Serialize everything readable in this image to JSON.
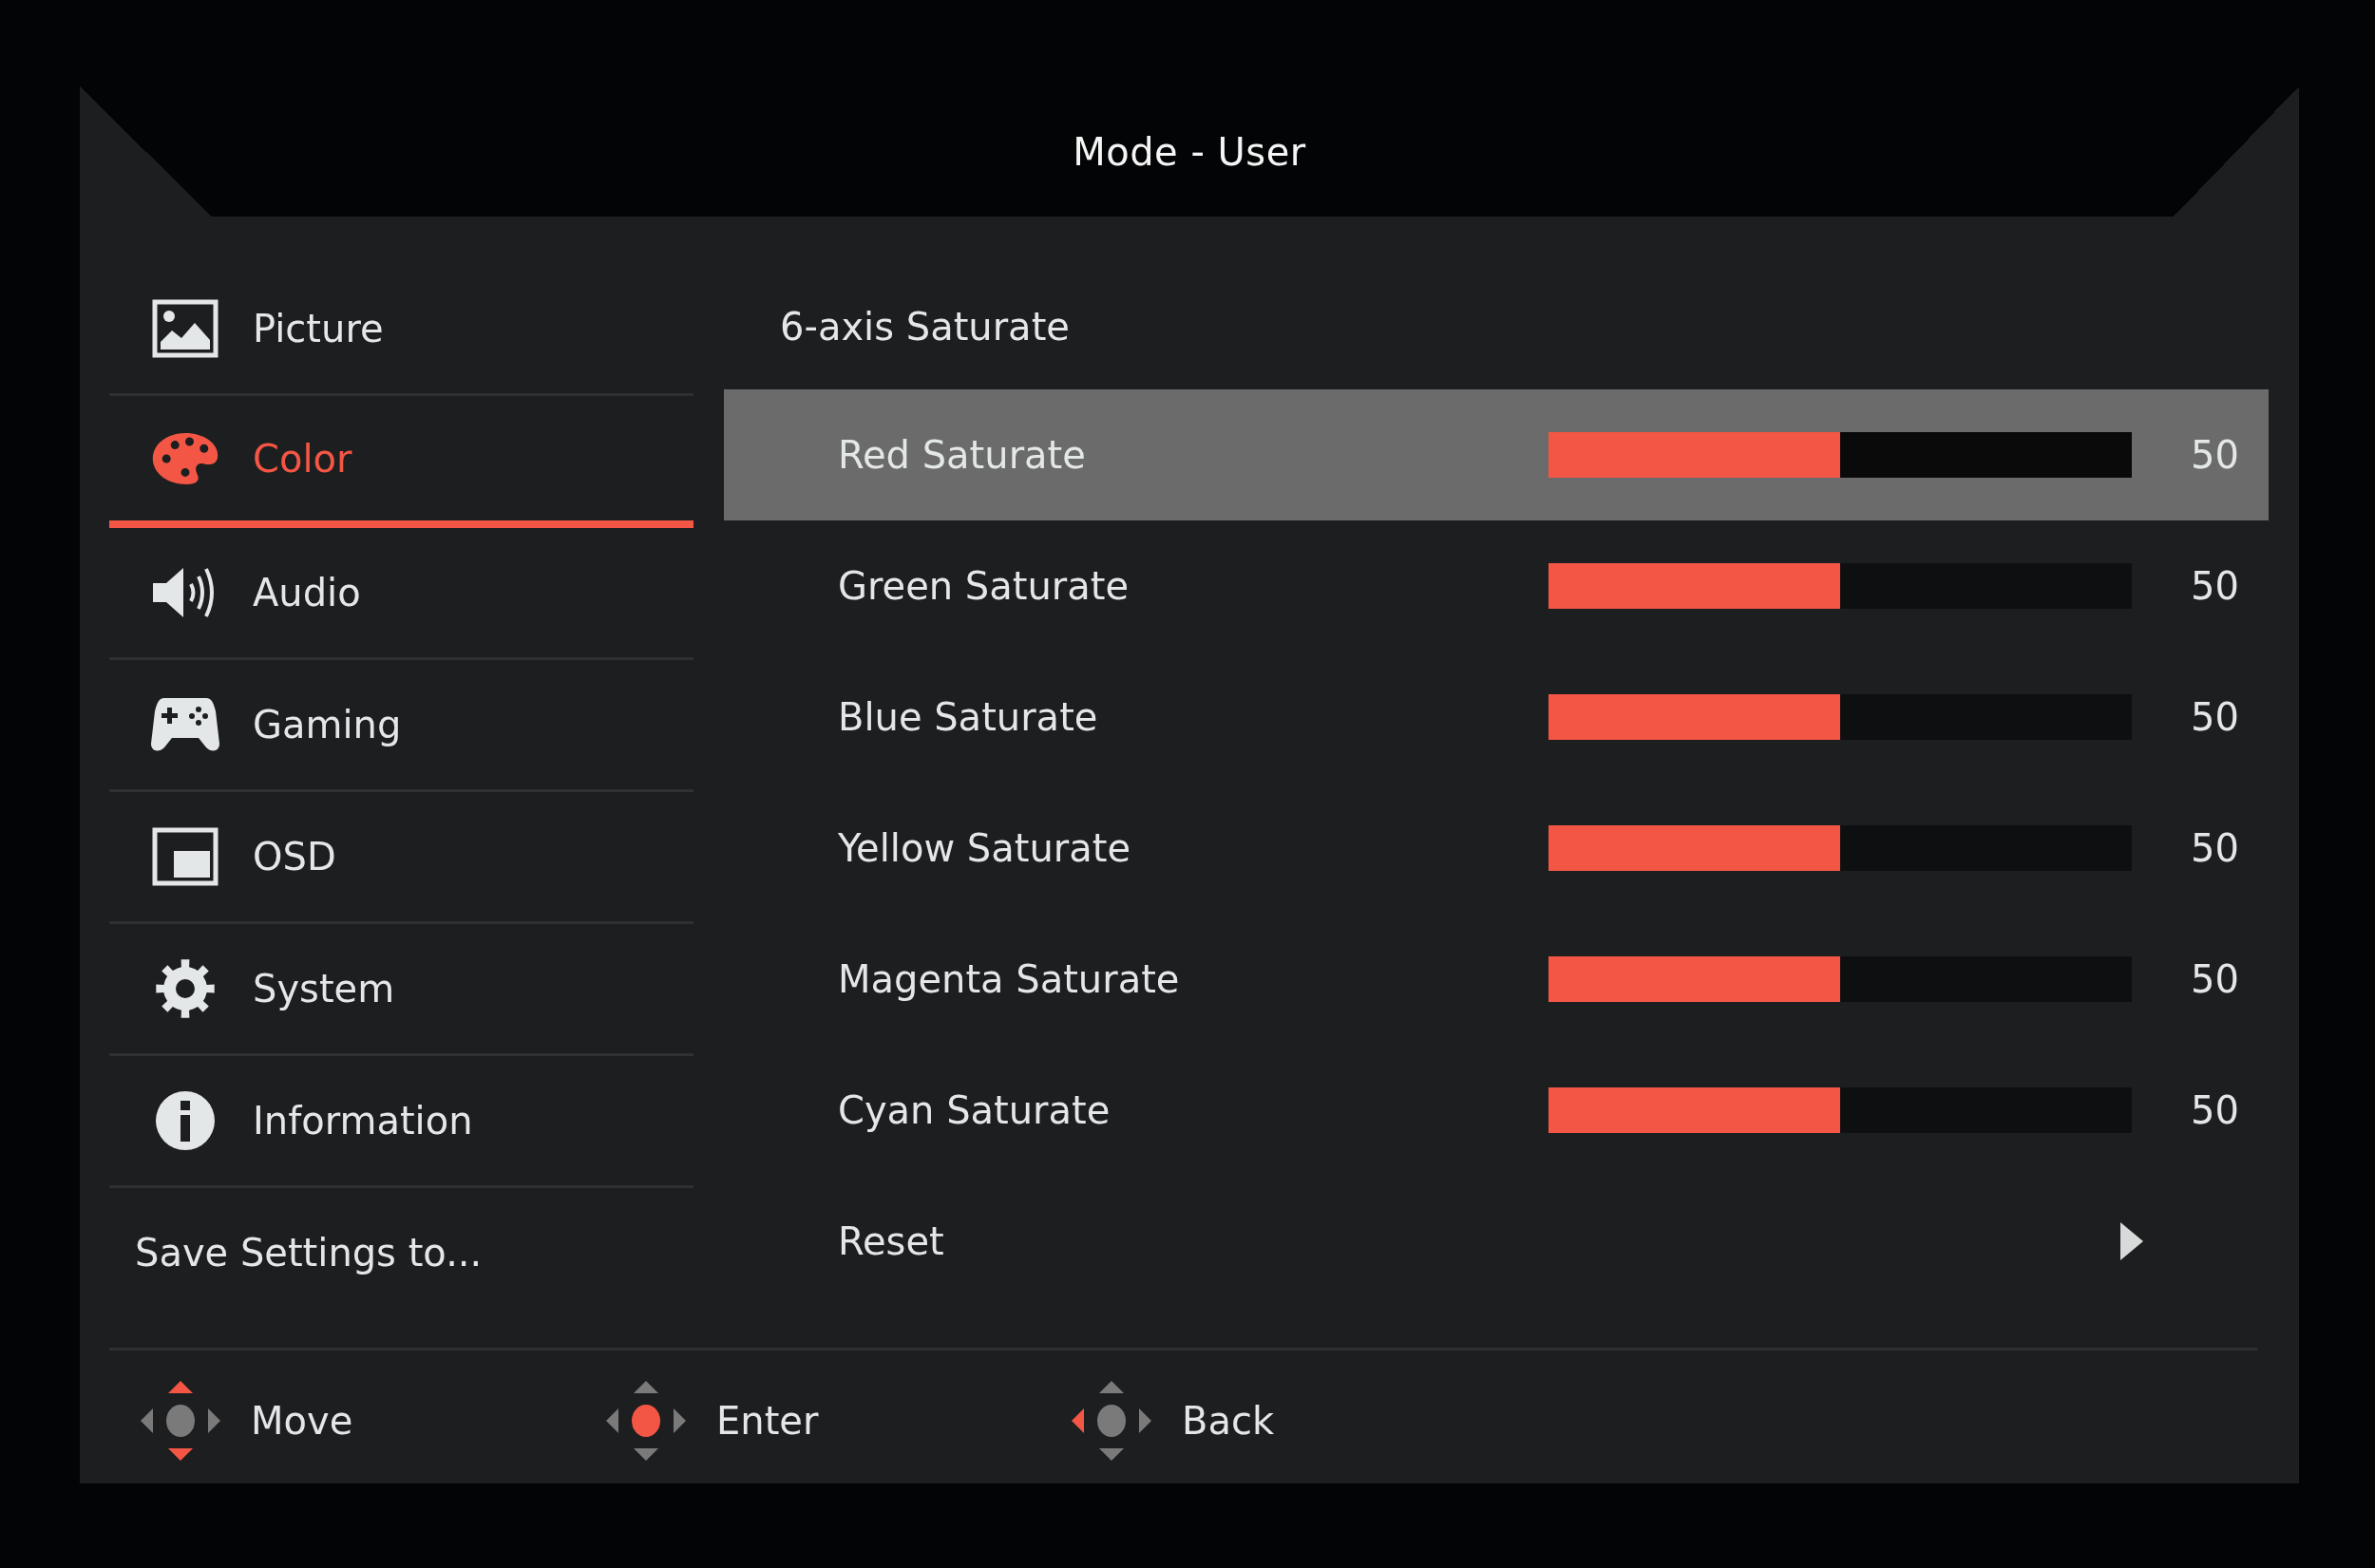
{
  "title": "Mode - User",
  "sidebar": {
    "items": [
      {
        "label": "Picture",
        "selected": false
      },
      {
        "label": "Color",
        "selected": true
      },
      {
        "label": "Audio",
        "selected": false
      },
      {
        "label": "Gaming",
        "selected": false
      },
      {
        "label": "OSD",
        "selected": false
      },
      {
        "label": "System",
        "selected": false
      },
      {
        "label": "Information",
        "selected": false
      }
    ],
    "save_settings": "Save Settings to..."
  },
  "content": {
    "section_title": "6-axis Saturate",
    "settings": [
      {
        "kind": "slider",
        "label": "Red Saturate",
        "level": 0.5,
        "reading": "50",
        "selected": true
      },
      {
        "kind": "slider",
        "label": "Green Saturate",
        "level": 0.5,
        "reading": "50",
        "selected": false
      },
      {
        "kind": "slider",
        "label": "Blue Saturate",
        "level": 0.5,
        "reading": "50",
        "selected": false
      },
      {
        "kind": "slider",
        "label": "Yellow Saturate",
        "level": 0.5,
        "reading": "50",
        "selected": false
      },
      {
        "kind": "slider",
        "label": "Magenta Saturate",
        "level": 0.5,
        "reading": "50",
        "selected": false
      },
      {
        "kind": "slider",
        "label": "Cyan Saturate",
        "level": 0.5,
        "reading": "50",
        "selected": false
      },
      {
        "kind": "submenu",
        "label": "Reset",
        "selected": false
      }
    ]
  },
  "footer": {
    "hints": [
      {
        "kind": "move",
        "label": "Move"
      },
      {
        "kind": "enter",
        "label": "Enter"
      },
      {
        "kind": "back",
        "label": "Back"
      }
    ]
  }
}
